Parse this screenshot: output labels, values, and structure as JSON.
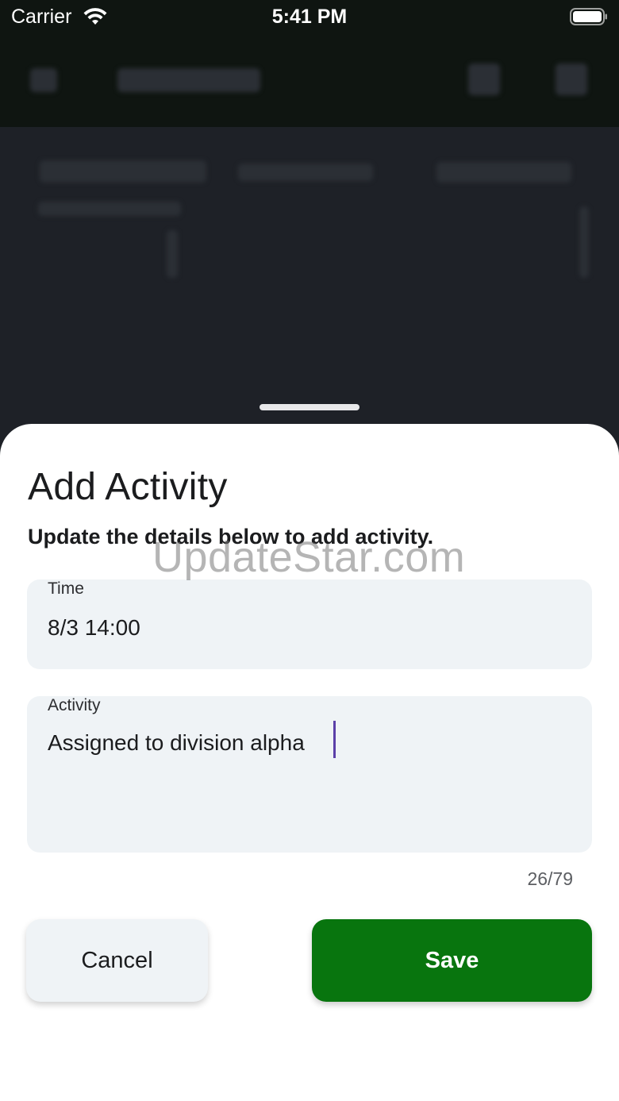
{
  "status_bar": {
    "carrier": "Carrier",
    "time": "5:41 PM",
    "wifi_icon": "wifi-icon",
    "battery_icon": "battery-icon"
  },
  "sheet": {
    "title": "Add Activity",
    "subtitle": "Update the details below to add activity.",
    "watermark": "UpdateStar.com",
    "time_field": {
      "label": "Time",
      "value": "8/3 14:00"
    },
    "activity_field": {
      "label": "Activity",
      "value": "Assigned to division alpha",
      "counter": "26/79"
    },
    "buttons": {
      "cancel_label": "Cancel",
      "save_label": "Save"
    }
  },
  "colors": {
    "save_green": "#08750e",
    "field_bg": "#eff3f6",
    "caret": "#5b3fa8"
  }
}
